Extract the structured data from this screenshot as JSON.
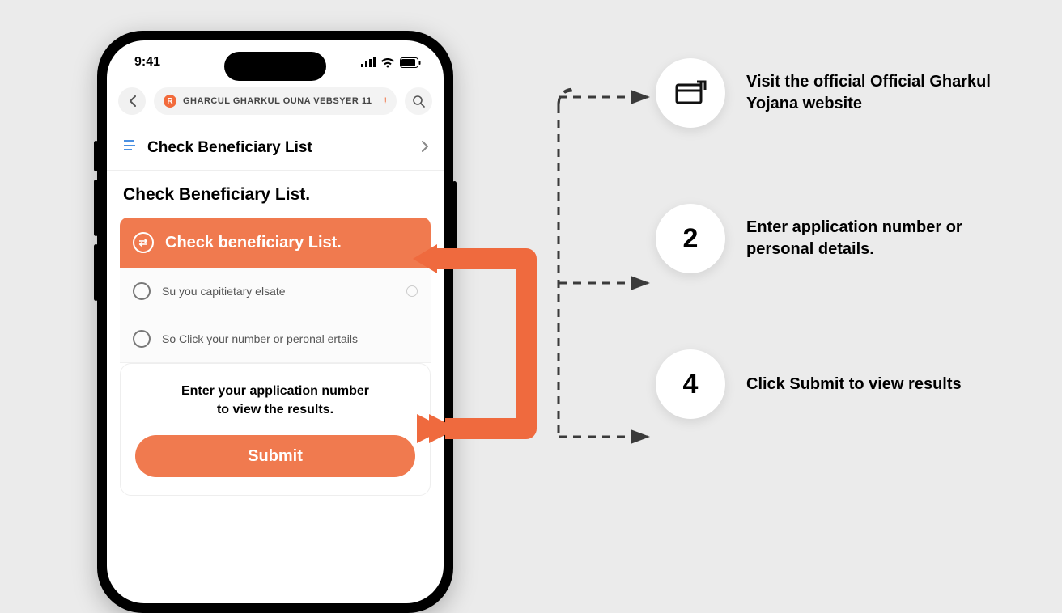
{
  "statusBar": {
    "time": "9:41"
  },
  "nav": {
    "addressText": "GHARCUL GHARKUL OUNA VEBSYER 11",
    "navItemLabel": "Check Beneficiary List"
  },
  "page": {
    "title": "Check Beneficiary List.",
    "bannerTitle": "Check beneficiary List.",
    "options": [
      "Su you capitietary elsate",
      "So Click your number or peronal ertails"
    ],
    "hintLine1": "Enter your application number",
    "hintLine2": "to view the results.",
    "submitLabel": "Submit"
  },
  "steps": [
    {
      "badge": "icon",
      "text": "Visit the official Official Gharkul Yojana website"
    },
    {
      "badge": "2",
      "text": "Enter   application number or personal details."
    },
    {
      "badge": "4",
      "text": "Click Submit to view results"
    }
  ]
}
